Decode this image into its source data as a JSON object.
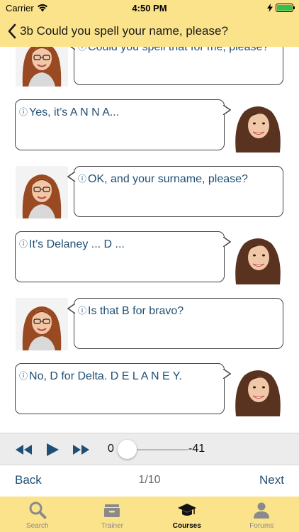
{
  "status_bar": {
    "carrier": "Carrier",
    "time": "4:50 PM",
    "battery_percent": 100
  },
  "nav": {
    "back_icon": "chevron-left-icon",
    "title": "3b Could you spell your name, please?"
  },
  "conversation": {
    "info_symbol": "ⓘ",
    "messages": [
      {
        "speaker": "teacher",
        "text": "Could you spell that for me, please?"
      },
      {
        "speaker": "student",
        "text": "Yes, it’s A N N A..."
      },
      {
        "speaker": "teacher",
        "text": "OK, and your surname, please?"
      },
      {
        "speaker": "student",
        "text": "It’s Delaney ... D ..."
      },
      {
        "speaker": "teacher",
        "text": "Is that B for bravo?"
      },
      {
        "speaker": "student",
        "text": "No, D for Delta. D E L A N E Y."
      }
    ]
  },
  "player": {
    "rewind_icon": "rewind-icon",
    "play_icon": "play-icon",
    "forward_icon": "fast-forward-icon",
    "time_elapsed": "0",
    "time_remaining": "-41",
    "progress": 0
  },
  "pager": {
    "back_label": "Back",
    "page_indicator": "1/10",
    "next_label": "Next"
  },
  "tabs": [
    {
      "label": "Search",
      "icon": "search-icon",
      "active": false
    },
    {
      "label": "Trainer",
      "icon": "card-box-icon",
      "active": false
    },
    {
      "label": "Courses",
      "icon": "graduation-cap-icon",
      "active": true
    },
    {
      "label": "Forums",
      "icon": "person-icon",
      "active": false
    }
  ],
  "colors": {
    "bar_background": "#fbe38c",
    "text_blue": "#1f4f74",
    "player_background": "#ececec"
  }
}
